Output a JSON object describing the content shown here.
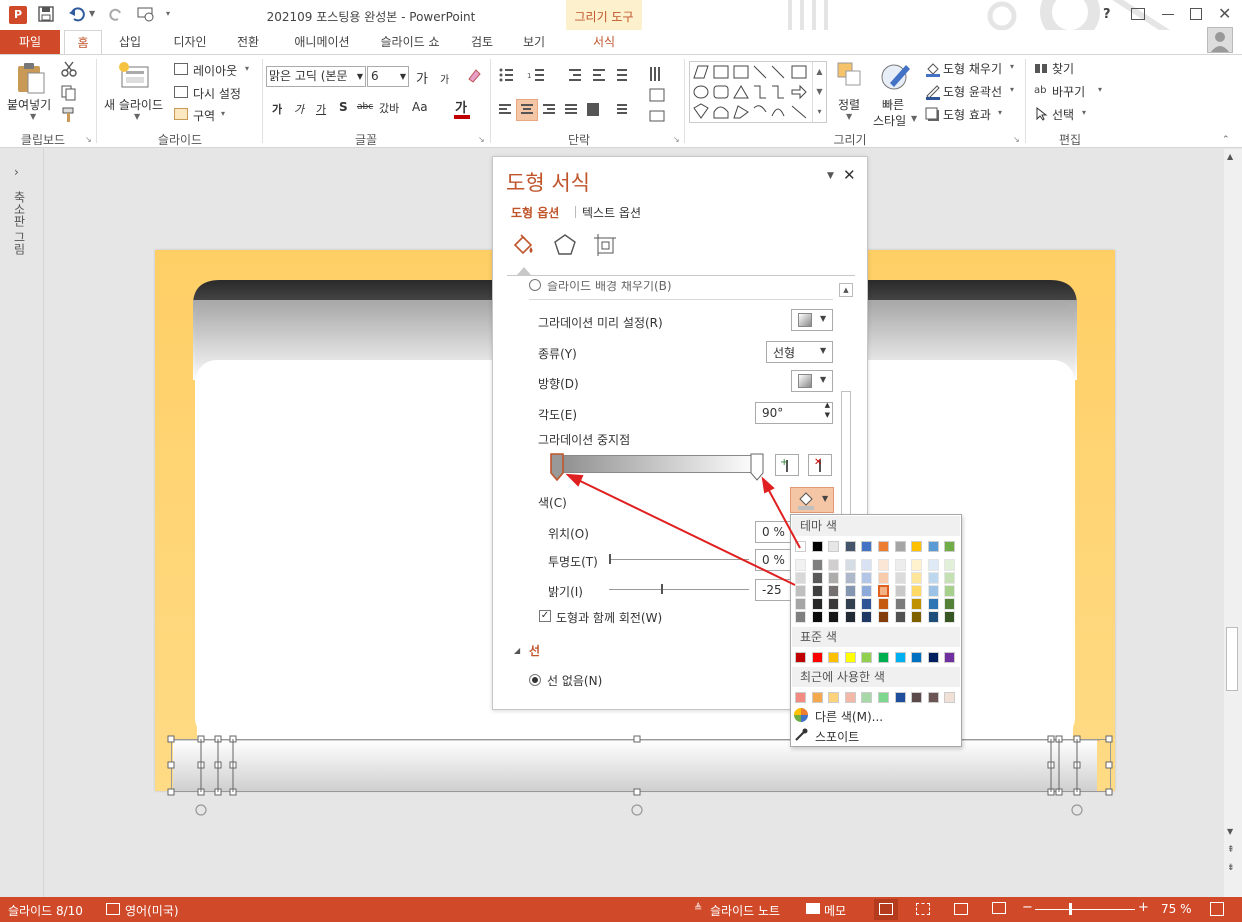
{
  "title_bar": {
    "document_title": "202109 포스팅용 완성본 - PowerPoint",
    "contextual_tab_group": "그리기 도구",
    "help": "?",
    "window_buttons": [
      "minimize",
      "restore",
      "close"
    ]
  },
  "tabs": [
    "파일",
    "홈",
    "삽입",
    "디자인",
    "전환",
    "애니메이션",
    "슬라이드 쇼",
    "검토",
    "보기",
    "서식"
  ],
  "active_tab": "홈",
  "ribbon": {
    "clipboard": {
      "paste": "붙여넣기",
      "group": "클립보드"
    },
    "slides": {
      "new_slide": "새 슬라이드",
      "layout": "레이아웃",
      "reset": "다시 설정",
      "section": "구역",
      "group": "슬라이드"
    },
    "font": {
      "font_name": "맑은 고딕 (본문",
      "font_size": "6",
      "group": "글꼴",
      "grow": "가",
      "shrink": "가",
      "bold": "가",
      "italic": "가",
      "underline": "가",
      "shadow": "S",
      "strike": "abc",
      "spacing": "갔바",
      "case": "Aa",
      "color": "가"
    },
    "paragraph": {
      "group": "단락"
    },
    "drawing": {
      "arrange": "정렬",
      "quick_styles": "빠른",
      "quick_styles_2": "스타일",
      "fill": "도형 채우기",
      "outline": "도형 윤곽선",
      "effects": "도형 효과",
      "group": "그리기"
    },
    "editing": {
      "find": "찾기",
      "replace": "바꾸기",
      "select": "선택",
      "group": "편집"
    }
  },
  "thumbnail_pane": {
    "label": "축소판 그림"
  },
  "format_pane": {
    "title": "도형 서식",
    "tab_shape": "도형 옵션",
    "tab_text": "텍스트 옵션",
    "partial_option": "슬라이드 배경 채우기(B)",
    "preset_gradient": "그라데이션 미리 설정(R)",
    "type_label": "종류(Y)",
    "type_value": "선형",
    "direction_label": "방향(D)",
    "angle_label": "각도(E)",
    "angle_value": "90°",
    "stops_label": "그라데이션 중지점",
    "color_label": "색(C)",
    "position_label": "위치(O)",
    "position_value": "0 %",
    "transparency_label": "투명도(T)",
    "transparency_value": "0 %",
    "brightness_label": "밝기(I)",
    "brightness_value": "-25 %",
    "rotate_with_shape": "도형과 함께 회전(W)",
    "line_section": "선",
    "no_line": "선 없음(N)"
  },
  "color_palette": {
    "theme_header": "테마 색",
    "standard_header": "표준 색",
    "recent_header": "최근에 사용한 색",
    "more_colors": "다른 색(M)...",
    "eyedropper": "스포이트",
    "theme_top": [
      "#ffffff",
      "#000000",
      "#e7e6e6",
      "#44546a",
      "#4472c4",
      "#ed7d31",
      "#a5a5a5",
      "#ffc000",
      "#5b9bd5",
      "#70ad47"
    ],
    "theme_shades": [
      [
        "#f2f2f2",
        "#7f7f7f",
        "#d0cece",
        "#d6dce4",
        "#d9e2f3",
        "#fbe5d5",
        "#ededed",
        "#fff2cc",
        "#deebf6",
        "#e2efd9"
      ],
      [
        "#d8d8d8",
        "#595959",
        "#aeabab",
        "#adb9ca",
        "#b4c6e7",
        "#f7cbac",
        "#dbdbdb",
        "#fee599",
        "#bdd7ee",
        "#c5e0b3"
      ],
      [
        "#bfbfbf",
        "#3f3f3f",
        "#757070",
        "#8496b0",
        "#8eaadb",
        "#f4b183",
        "#c9c9c9",
        "#ffd965",
        "#9cc3e5",
        "#a8d08d"
      ],
      [
        "#a5a5a5",
        "#262626",
        "#3a3838",
        "#323f4f",
        "#2f5496",
        "#c55a11",
        "#7b7b7b",
        "#bf9000",
        "#2e75b5",
        "#538135"
      ],
      [
        "#7f7f7f",
        "#0c0c0c",
        "#171616",
        "#222a35",
        "#1f3864",
        "#833c0b",
        "#525252",
        "#7f6000",
        "#1e4e79",
        "#375623"
      ]
    ],
    "standard": [
      "#c00000",
      "#ff0000",
      "#ffc000",
      "#ffff00",
      "#92d050",
      "#00b050",
      "#00b0f0",
      "#0070c0",
      "#002060",
      "#7030a0"
    ],
    "recent": [
      "#f28b82",
      "#f4a94e",
      "#fcd37a",
      "#f4b8a8",
      "#a8d8a8",
      "#7ed68f",
      "#1f4e9c",
      "#5c4a4a",
      "#6b5454",
      "#f0e0d6"
    ],
    "selected_swatch": "#f4b183"
  },
  "status_bar": {
    "slide_info": "슬라이드 8/10",
    "language": "영어(미국)",
    "notes": "슬라이드 노트",
    "comments": "메모",
    "zoom": "75 %"
  },
  "colors": {
    "accent": "#d04a2a",
    "frame_orange": "#ffd67a",
    "arrow_red": "#e02020"
  }
}
